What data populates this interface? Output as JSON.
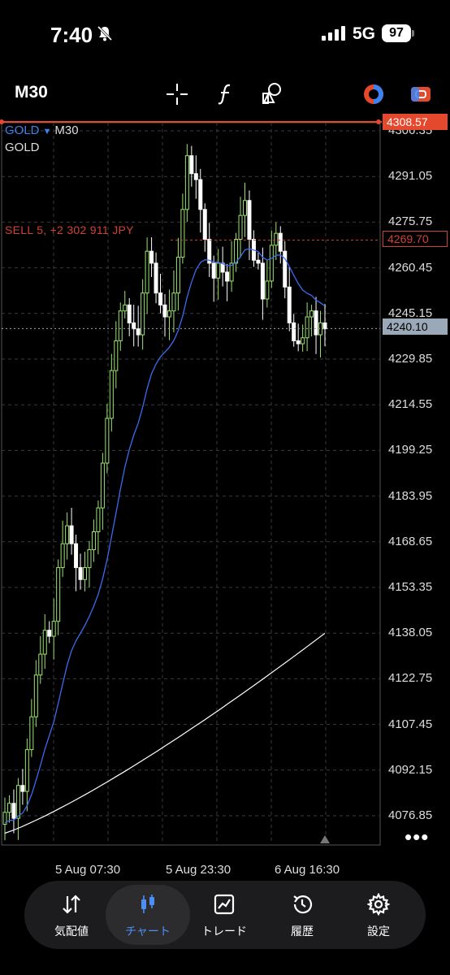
{
  "status_bar": {
    "time": "7:40",
    "network": "5G",
    "battery": "97"
  },
  "toolbar": {
    "timeframe": "M30",
    "icons": [
      "crosshair-icon",
      "indicators-icon",
      "objects-icon",
      "trading-icon",
      "toggle-icon"
    ]
  },
  "chart": {
    "symbol": "GOLD",
    "timeframe": "M30",
    "description": "GOLD",
    "position_label": "SELL 5, +2 302 911 JPY",
    "price_tags": {
      "top": "4308.57",
      "sell": "4269.70",
      "current": "4240.10"
    },
    "y_ticks": [
      "4306.35",
      "4291.05",
      "4275.75",
      "4260.45",
      "4245.15",
      "4229.85",
      "4214.55",
      "4199.25",
      "4183.95",
      "4168.65",
      "4153.35",
      "4138.05",
      "4122.75",
      "4107.45",
      "4092.15",
      "4076.85"
    ],
    "x_ticks": [
      "5 Aug 07:30",
      "5 Aug 23:30",
      "6 Aug 16:30"
    ],
    "colors": {
      "bull": "#9be46f",
      "bear": "#ffffff",
      "ma_fast": "#3a6cf0",
      "ma_slow": "#ffffff",
      "grid": "#3a3a3a",
      "sell_line": "#d04234"
    }
  },
  "chart_data": {
    "type": "candlestick",
    "symbol": "GOLD",
    "timeframe": "M30",
    "ylim": [
      4070,
      4310
    ],
    "candles_close": [
      4078,
      4081,
      4076,
      4087,
      4085,
      4099,
      4110,
      4124,
      4131,
      4139,
      4137,
      4142,
      4160,
      4168,
      4174,
      4168,
      4160,
      4156,
      4160,
      4166,
      4172,
      4180,
      4195,
      4210,
      4226,
      4236,
      4246,
      4248,
      4242,
      4240,
      4238,
      4252,
      4266,
      4262,
      4252,
      4248,
      4244,
      4246,
      4252,
      4264,
      4280,
      4298,
      4292,
      4290,
      4280,
      4270,
      4262,
      4257,
      4262,
      4259,
      4256,
      4262,
      4270,
      4278,
      4283,
      4270,
      4263,
      4262,
      4250,
      4256,
      4268,
      4272,
      4266,
      4254,
      4242,
      4236,
      4235,
      4237,
      4244,
      4246,
      4238,
      4242,
      4240
    ],
    "ma_fast_range": [
      4082,
      4250
    ],
    "ma_slow_range": [
      4071,
      4138
    ],
    "current_price": 4240.1,
    "sell_price": 4269.7
  },
  "tabbar": {
    "tabs": [
      {
        "name": "tab-quotes",
        "label": "気配値",
        "icon": "arrows-icon"
      },
      {
        "name": "tab-chart",
        "label": "チャート",
        "icon": "candles-icon"
      },
      {
        "name": "tab-trade",
        "label": "トレード",
        "icon": "trade-chart-icon"
      },
      {
        "name": "tab-history",
        "label": "履歴",
        "icon": "history-icon"
      },
      {
        "name": "tab-settings",
        "label": "設定",
        "icon": "settings-icon"
      }
    ]
  }
}
